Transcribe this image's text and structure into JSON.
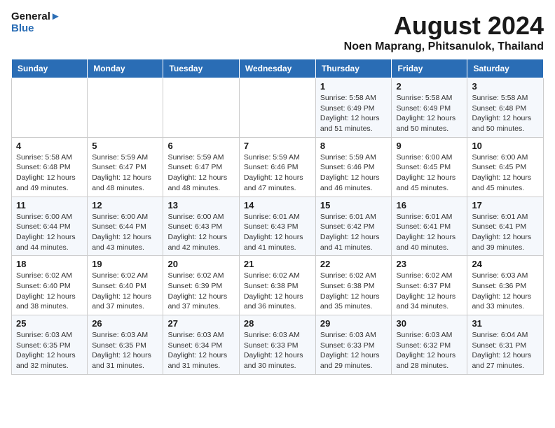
{
  "logo": {
    "text_general": "General",
    "text_blue": "Blue"
  },
  "title": "August 2024",
  "subtitle": "Noen Maprang, Phitsanulok, Thailand",
  "days_of_week": [
    "Sunday",
    "Monday",
    "Tuesday",
    "Wednesday",
    "Thursday",
    "Friday",
    "Saturday"
  ],
  "weeks": [
    [
      {
        "day": "",
        "info": ""
      },
      {
        "day": "",
        "info": ""
      },
      {
        "day": "",
        "info": ""
      },
      {
        "day": "",
        "info": ""
      },
      {
        "day": "1",
        "info": "Sunrise: 5:58 AM\nSunset: 6:49 PM\nDaylight: 12 hours\nand 51 minutes."
      },
      {
        "day": "2",
        "info": "Sunrise: 5:58 AM\nSunset: 6:49 PM\nDaylight: 12 hours\nand 50 minutes."
      },
      {
        "day": "3",
        "info": "Sunrise: 5:58 AM\nSunset: 6:48 PM\nDaylight: 12 hours\nand 50 minutes."
      }
    ],
    [
      {
        "day": "4",
        "info": "Sunrise: 5:58 AM\nSunset: 6:48 PM\nDaylight: 12 hours\nand 49 minutes."
      },
      {
        "day": "5",
        "info": "Sunrise: 5:59 AM\nSunset: 6:47 PM\nDaylight: 12 hours\nand 48 minutes."
      },
      {
        "day": "6",
        "info": "Sunrise: 5:59 AM\nSunset: 6:47 PM\nDaylight: 12 hours\nand 48 minutes."
      },
      {
        "day": "7",
        "info": "Sunrise: 5:59 AM\nSunset: 6:46 PM\nDaylight: 12 hours\nand 47 minutes."
      },
      {
        "day": "8",
        "info": "Sunrise: 5:59 AM\nSunset: 6:46 PM\nDaylight: 12 hours\nand 46 minutes."
      },
      {
        "day": "9",
        "info": "Sunrise: 6:00 AM\nSunset: 6:45 PM\nDaylight: 12 hours\nand 45 minutes."
      },
      {
        "day": "10",
        "info": "Sunrise: 6:00 AM\nSunset: 6:45 PM\nDaylight: 12 hours\nand 45 minutes."
      }
    ],
    [
      {
        "day": "11",
        "info": "Sunrise: 6:00 AM\nSunset: 6:44 PM\nDaylight: 12 hours\nand 44 minutes."
      },
      {
        "day": "12",
        "info": "Sunrise: 6:00 AM\nSunset: 6:44 PM\nDaylight: 12 hours\nand 43 minutes."
      },
      {
        "day": "13",
        "info": "Sunrise: 6:00 AM\nSunset: 6:43 PM\nDaylight: 12 hours\nand 42 minutes."
      },
      {
        "day": "14",
        "info": "Sunrise: 6:01 AM\nSunset: 6:43 PM\nDaylight: 12 hours\nand 41 minutes."
      },
      {
        "day": "15",
        "info": "Sunrise: 6:01 AM\nSunset: 6:42 PM\nDaylight: 12 hours\nand 41 minutes."
      },
      {
        "day": "16",
        "info": "Sunrise: 6:01 AM\nSunset: 6:41 PM\nDaylight: 12 hours\nand 40 minutes."
      },
      {
        "day": "17",
        "info": "Sunrise: 6:01 AM\nSunset: 6:41 PM\nDaylight: 12 hours\nand 39 minutes."
      }
    ],
    [
      {
        "day": "18",
        "info": "Sunrise: 6:02 AM\nSunset: 6:40 PM\nDaylight: 12 hours\nand 38 minutes."
      },
      {
        "day": "19",
        "info": "Sunrise: 6:02 AM\nSunset: 6:40 PM\nDaylight: 12 hours\nand 37 minutes."
      },
      {
        "day": "20",
        "info": "Sunrise: 6:02 AM\nSunset: 6:39 PM\nDaylight: 12 hours\nand 37 minutes."
      },
      {
        "day": "21",
        "info": "Sunrise: 6:02 AM\nSunset: 6:38 PM\nDaylight: 12 hours\nand 36 minutes."
      },
      {
        "day": "22",
        "info": "Sunrise: 6:02 AM\nSunset: 6:38 PM\nDaylight: 12 hours\nand 35 minutes."
      },
      {
        "day": "23",
        "info": "Sunrise: 6:02 AM\nSunset: 6:37 PM\nDaylight: 12 hours\nand 34 minutes."
      },
      {
        "day": "24",
        "info": "Sunrise: 6:03 AM\nSunset: 6:36 PM\nDaylight: 12 hours\nand 33 minutes."
      }
    ],
    [
      {
        "day": "25",
        "info": "Sunrise: 6:03 AM\nSunset: 6:35 PM\nDaylight: 12 hours\nand 32 minutes."
      },
      {
        "day": "26",
        "info": "Sunrise: 6:03 AM\nSunset: 6:35 PM\nDaylight: 12 hours\nand 31 minutes."
      },
      {
        "day": "27",
        "info": "Sunrise: 6:03 AM\nSunset: 6:34 PM\nDaylight: 12 hours\nand 31 minutes."
      },
      {
        "day": "28",
        "info": "Sunrise: 6:03 AM\nSunset: 6:33 PM\nDaylight: 12 hours\nand 30 minutes."
      },
      {
        "day": "29",
        "info": "Sunrise: 6:03 AM\nSunset: 6:33 PM\nDaylight: 12 hours\nand 29 minutes."
      },
      {
        "day": "30",
        "info": "Sunrise: 6:03 AM\nSunset: 6:32 PM\nDaylight: 12 hours\nand 28 minutes."
      },
      {
        "day": "31",
        "info": "Sunrise: 6:04 AM\nSunset: 6:31 PM\nDaylight: 12 hours\nand 27 minutes."
      }
    ]
  ]
}
